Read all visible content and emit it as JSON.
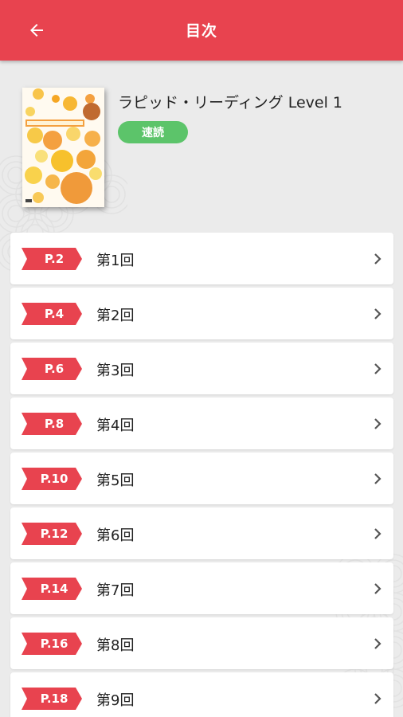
{
  "appbar": {
    "title": "目次",
    "back_icon": "arrow-left-icon",
    "color": "#e8434f"
  },
  "book": {
    "title": "ラピッド・リーディング Level 1",
    "tag": "速読",
    "tag_color": "#5cc46a"
  },
  "toc": {
    "items": [
      {
        "page": "P.2",
        "label": "第1回"
      },
      {
        "page": "P.4",
        "label": "第2回"
      },
      {
        "page": "P.6",
        "label": "第3回"
      },
      {
        "page": "P.8",
        "label": "第4回"
      },
      {
        "page": "P.10",
        "label": "第5回"
      },
      {
        "page": "P.12",
        "label": "第6回"
      },
      {
        "page": "P.14",
        "label": "第7回"
      },
      {
        "page": "P.16",
        "label": "第8回"
      },
      {
        "page": "P.18",
        "label": "第9回"
      }
    ],
    "chevron_icon": "chevron-right-icon"
  }
}
